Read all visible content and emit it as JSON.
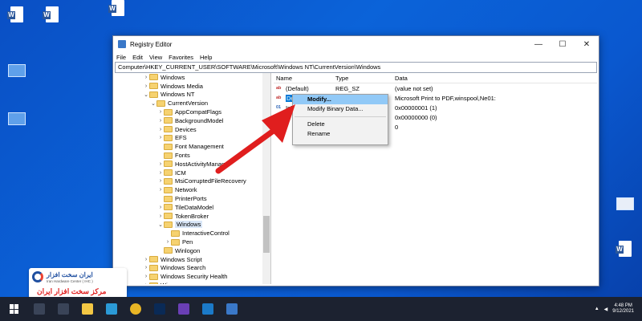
{
  "window": {
    "title": "Registry Editor",
    "controls": {
      "minimize": "—",
      "maximize": "☐",
      "close": "✕"
    },
    "menu": [
      "File",
      "Edit",
      "View",
      "Favorites",
      "Help"
    ],
    "address": "Computer\\HKEY_CURRENT_USER\\SOFTWARE\\Microsoft\\Windows NT\\CurrentVersion\\Windows"
  },
  "tree": [
    {
      "label": "Windows",
      "chev": "›"
    },
    {
      "label": "Windows Media",
      "chev": "›"
    },
    {
      "label": "Windows NT",
      "chev": "⌄"
    },
    {
      "label": "CurrentVersion",
      "chev": "⌄"
    },
    {
      "label": "AppCompatFlags",
      "chev": "›"
    },
    {
      "label": "BackgroundModel",
      "chev": "›"
    },
    {
      "label": "Devices",
      "chev": "›"
    },
    {
      "label": "EFS",
      "chev": "›"
    },
    {
      "label": "Font Management",
      "chev": ""
    },
    {
      "label": "Fonts",
      "chev": ""
    },
    {
      "label": "HostActivityManag",
      "chev": "›"
    },
    {
      "label": "ICM",
      "chev": "›"
    },
    {
      "label": "MsiCorruptedFileRecovery",
      "chev": "›"
    },
    {
      "label": "Network",
      "chev": "›"
    },
    {
      "label": "PrinterPorts",
      "chev": ""
    },
    {
      "label": "TileDataModel",
      "chev": "›"
    },
    {
      "label": "TokenBroker",
      "chev": "›"
    },
    {
      "label": "Windows",
      "chev": "⌄",
      "selected": true
    },
    {
      "label": "InteractiveControl",
      "chev": ""
    },
    {
      "label": "Pen",
      "chev": "›"
    },
    {
      "label": "Winlogon",
      "chev": ""
    },
    {
      "label": "Windows Script",
      "chev": "›"
    },
    {
      "label": "Windows Search",
      "chev": "›"
    },
    {
      "label": "Windows Security Health",
      "chev": "›"
    },
    {
      "label": "Wisp",
      "chev": "›"
    }
  ],
  "list": {
    "headers": {
      "name": "Name",
      "type": "Type",
      "data": "Data"
    },
    "rows": [
      {
        "icon": "ab",
        "name": "(Default)",
        "type": "REG_SZ",
        "data": "(value not set)"
      },
      {
        "icon": "ab",
        "name": "De",
        "type": "",
        "data": "Microsoft Print to PDF,winspool,Ne01:",
        "selected": true
      },
      {
        "icon": "01",
        "name": "IsM",
        "type": "",
        "data": "0x00000001 (1)"
      },
      {
        "icon": "01",
        "name": "",
        "type": "",
        "data": "0x00000000 (0)"
      },
      {
        "icon": "",
        "name": "",
        "type": "",
        "data": "0"
      }
    ]
  },
  "context_menu": {
    "items": [
      "Modify...",
      "Modify Binary Data...",
      "Delete",
      "Rename"
    ]
  },
  "desktop_left": [
    "",
    "",
    "",
    ""
  ],
  "logo": {
    "line1": "ایران سخت افزار",
    "line2": "Iran Hardware Center ( IHC )",
    "line3": "مرکز سخت افزار ایران"
  },
  "taskbar": {
    "time": "4:48 PM",
    "date": "9/12/2021"
  },
  "colors": {
    "desktop": "#0b5fd6",
    "selection": "#0078d7",
    "menu_highlight": "#91c9f7",
    "arrow": "#e01e1e"
  }
}
